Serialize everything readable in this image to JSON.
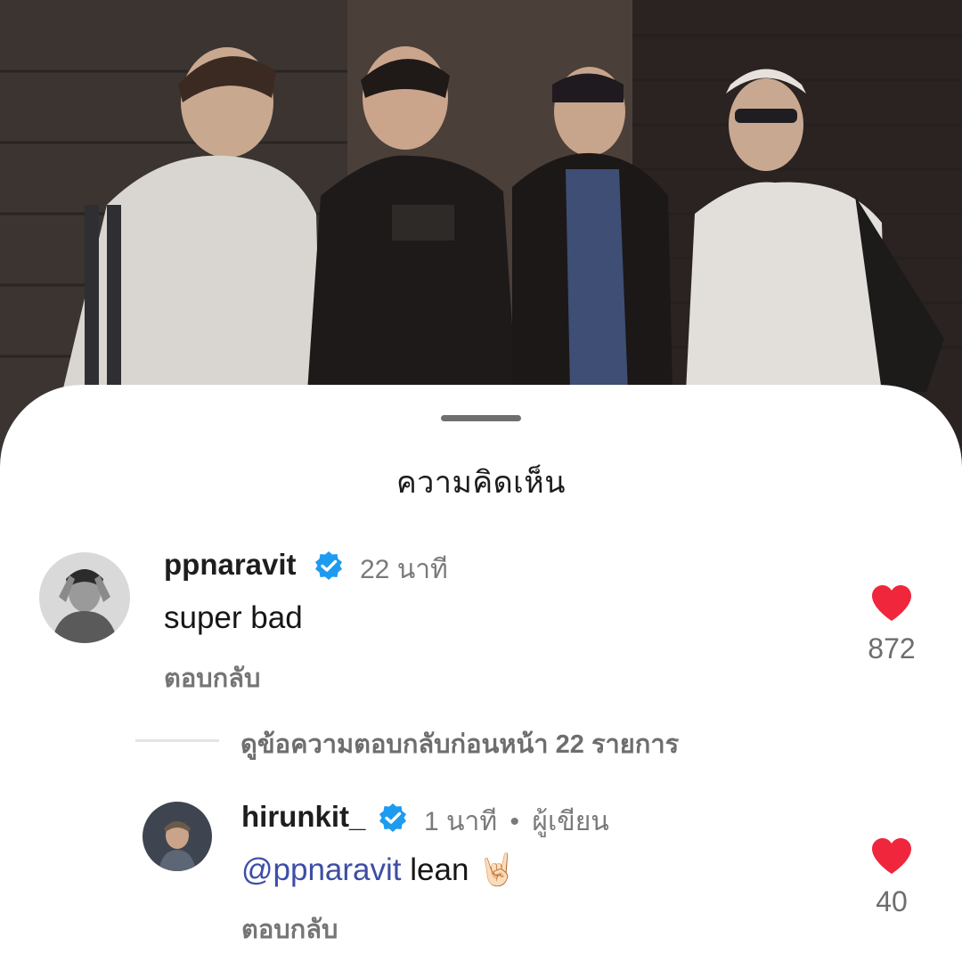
{
  "sheet": {
    "title": "ความคิดเห็น"
  },
  "comments": [
    {
      "username": "ppnaravit",
      "verified": true,
      "time": "22 นาที",
      "text": "super bad",
      "reply_label": "ตอบกลับ",
      "likes": "872"
    }
  ],
  "view_more": {
    "label": "ดูข้อความตอบกลับก่อนหน้า 22 รายการ"
  },
  "replies": [
    {
      "username": "hirunkit_",
      "verified": true,
      "time": "1 นาที",
      "separator": "•",
      "role": "ผู้เขียน",
      "mention": "@ppnaravit",
      "text": " lean ",
      "emoji": "🤘🏻",
      "reply_label": "ตอบกลับ",
      "likes": "40"
    }
  ],
  "colors": {
    "verified_badge": "#1d9bf0",
    "like_heart": "#f0263d",
    "mention": "#3d4ea6"
  },
  "icons": [
    "verified-badge-icon",
    "heart-icon"
  ]
}
